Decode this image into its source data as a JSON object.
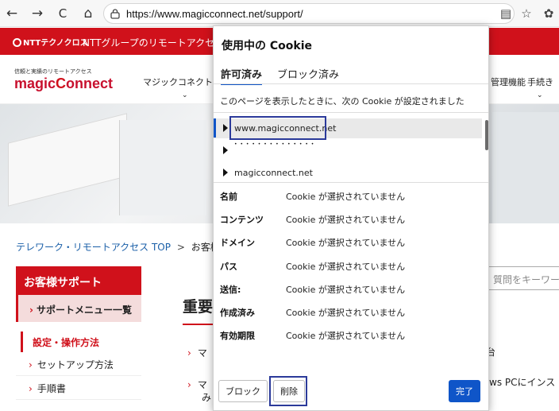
{
  "browser": {
    "url": "https://www.magicconnect.net/support/",
    "back_glyph": "←",
    "forward_glyph": "→",
    "reload_glyph": "C",
    "home_glyph": "⌂",
    "reader_glyph": "▤",
    "favorite_glyph": "☆",
    "extensions_glyph": "✿"
  },
  "site": {
    "ntt_logo": "NTTテクノクロス",
    "strip_text": "NTTグループのリモートアクセス",
    "tagline": "信頼と実績のリモートアクセス",
    "brand_left": "magic",
    "brand_c": "C",
    "brand_right": "onnect",
    "nav_items": [
      {
        "label": "マジックコネクト"
      },
      {
        "label": "管理機能"
      },
      {
        "label": "手続き"
      }
    ],
    "breadcrumb": {
      "home": "テレワーク・リモートアクセス TOP",
      "separator": ">",
      "current": "お客様サ"
    },
    "sidebar": {
      "header": "お客様サポート",
      "menu": "サポートメニュー一覧",
      "category": "設定・操作方法",
      "links": [
        "セットアップ方法",
        "手順書"
      ]
    },
    "main": {
      "title": "重要",
      "link1": "マ",
      "link2": "マ",
      "link2b": "み"
    },
    "search_placeholder": "質問をキーワード",
    "right_snippet1": "台",
    "right_snippet2": "ws PCにインス"
  },
  "cookie_popup": {
    "title": "使用中の Cookie",
    "tabs": [
      {
        "label": "許可済み",
        "active": true
      },
      {
        "label": "ブロック済み",
        "active": false
      }
    ],
    "notice": "このページを表示したときに、次の Cookie が設定されました",
    "sites": [
      {
        "host": "www.magicconnect.net",
        "selected": true
      },
      {
        "host": "",
        "garbled": "• • • • • • • • • • • • • •"
      },
      {
        "host": "magicconnect.net",
        "selected": false
      }
    ],
    "details": [
      {
        "label": "名前",
        "value": "Cookie が選択されていません"
      },
      {
        "label": "コンテンツ",
        "value": "Cookie が選択されていません"
      },
      {
        "label": "ドメイン",
        "value": "Cookie が選択されていません"
      },
      {
        "label": "パス",
        "value": "Cookie が選択されていません"
      },
      {
        "label": "送信:",
        "value": "Cookie が選択されていません"
      },
      {
        "label": "作成済み",
        "value": "Cookie が選択されていません"
      },
      {
        "label": "有効期限",
        "value": "Cookie が選択されていません"
      }
    ],
    "buttons": {
      "block": "ブロック",
      "delete": "削除",
      "done": "完了"
    },
    "colors": {
      "accent": "#0f55c8",
      "highlight_frame": "#2b3a9a"
    }
  }
}
